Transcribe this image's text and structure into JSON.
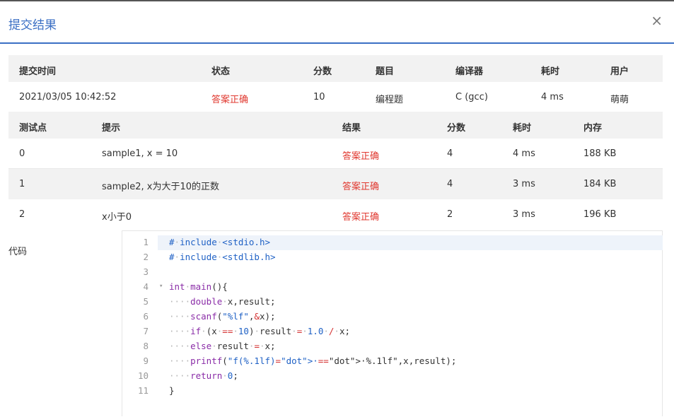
{
  "dialog": {
    "title": "提交结果",
    "close_label": "×"
  },
  "submission": {
    "headers": [
      "提交时间",
      "状态",
      "分数",
      "题目",
      "编译器",
      "耗时",
      "用户"
    ],
    "row": [
      "2021/03/05 10:42:52",
      "答案正确",
      "10",
      "编程题",
      "C (gcc)",
      "4 ms",
      "萌萌"
    ]
  },
  "tests": {
    "headers": [
      "测试点",
      "提示",
      "结果",
      "分数",
      "耗时",
      "内存"
    ],
    "rows": [
      [
        "0",
        "sample1, x = 10",
        "答案正确",
        "4",
        "4 ms",
        "188 KB"
      ],
      [
        "1",
        "sample2, x为大于10的正数",
        "答案正确",
        "4",
        "3 ms",
        "184 KB"
      ],
      [
        "2",
        "x小于0",
        "答案正确",
        "2",
        "3 ms",
        "196 KB"
      ]
    ]
  },
  "code": {
    "label": "代码",
    "lines": [
      "# include <stdio.h>",
      "# include <stdlib.h>",
      "",
      "int main(){",
      "    double x,result;",
      "    scanf(\"%lf\",&x);",
      "    if (x == 10) result = 1.0 / x;",
      "    else result = x;",
      "    printf(\"f(%.1lf) = %.1lf\",x,result);",
      "    return 0;",
      "}"
    ]
  },
  "colors": {
    "accent": "#3b6fc4",
    "status_ok": "#e0382f",
    "header_bg": "#f2f2f2"
  }
}
